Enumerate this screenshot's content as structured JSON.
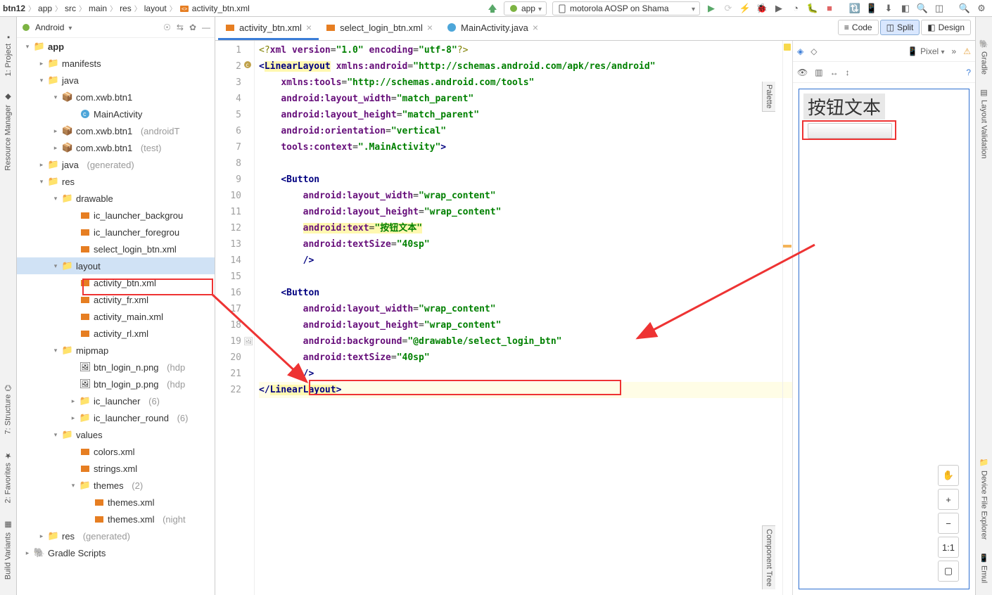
{
  "breadcrumb": {
    "root": "btn12",
    "p1": "app",
    "p2": "src",
    "p3": "main",
    "p4": "res",
    "p5": "layout",
    "file": "activity_btn.xml"
  },
  "run_config": "app",
  "device": "motorola AOSP on Shama",
  "proj_view_label": "Android",
  "tree": {
    "app": "app",
    "manifests": "manifests",
    "java": "java",
    "pkg1": "com.xwb.btn1",
    "mainact": "MainActivity",
    "pkg2": "com.xwb.btn1",
    "pkg2_suffix": "(androidT",
    "pkg3": "com.xwb.btn1",
    "pkg3_suffix": "(test)",
    "java_gen": "java",
    "java_gen_suffix": "(generated)",
    "res": "res",
    "drawable": "drawable",
    "ic_bg": "ic_launcher_backgrou",
    "ic_fg": "ic_launcher_foregrou",
    "sel_login": "select_login_btn.xml",
    "layout": "layout",
    "act_btn": "activity_btn.xml",
    "act_fr": "activity_fr.xml",
    "act_main": "activity_main.xml",
    "act_rl": "activity_rl.xml",
    "mipmap": "mipmap",
    "btnln": "btn_login_n.png",
    "btnln_s": "(hdp",
    "btnlp": "btn_login_p.png",
    "btnlp_s": "(hdp",
    "ic_launcher": "ic_launcher",
    "ic_launcher_c": "(6)",
    "ic_launcher_r": "ic_launcher_round",
    "ic_launcher_rc": "(6)",
    "values": "values",
    "colors": "colors.xml",
    "strings": "strings.xml",
    "themes_d": "themes",
    "themes_c": "(2)",
    "themes1": "themes.xml",
    "themes2": "themes.xml",
    "themes2_s": "(night",
    "res_gen": "res",
    "res_gen_s": "(generated)",
    "gradle": "Gradle Scripts"
  },
  "tabs": {
    "t1": "activity_btn.xml",
    "t2": "select_login_btn.xml",
    "t3": "MainActivity.java"
  },
  "view_switch": {
    "code": "Code",
    "split": "Split",
    "design": "Design"
  },
  "code_lines": {
    "l1_a": "<?",
    "l1_b": "xml version",
    "l1_c": "=",
    "l1_d": "\"1.0\"",
    "l1_e": " encoding",
    "l1_f": "=",
    "l1_g": "\"utf-8\"",
    "l1_h": "?>",
    "l2_a": "<",
    "l2_b": "LinearLayout",
    "l2_c": " ",
    "l2_d": "xmlns:android",
    "l2_e": "=",
    "l2_f": "\"http://schemas.android.com/apk/res/android\"",
    "l3_a": "xmlns:tools",
    "l3_b": "=",
    "l3_c": "\"http://schemas.android.com/tools\"",
    "l4_a": "android:layout_width",
    "l4_b": "=",
    "l4_c": "\"match_parent\"",
    "l5_a": "android:layout_height",
    "l5_b": "=",
    "l5_c": "\"match_parent\"",
    "l6_a": "android:orientation",
    "l6_b": "=",
    "l6_c": "\"vertical\"",
    "l7_a": "tools:context",
    "l7_b": "=",
    "l7_c": "\".MainActivity\"",
    "l7_d": ">",
    "l9_a": "<",
    "l9_b": "Button",
    "l10_a": "android:layout_width",
    "l10_b": "=",
    "l10_c": "\"wrap_content\"",
    "l11_a": "android:layout_height",
    "l11_b": "=",
    "l11_c": "\"wrap_content\"",
    "l12_a": "android:text",
    "l12_b": "=",
    "l12_c": "\"按钮文本\"",
    "l13_a": "android:textSize",
    "l13_b": "=",
    "l13_c": "\"40sp\"",
    "l14_a": "/>",
    "l16_a": "<",
    "l16_b": "Button",
    "l17_a": "android:layout_width",
    "l17_b": "=",
    "l17_c": "\"wrap_content\"",
    "l18_a": "android:layout_height",
    "l18_b": "=",
    "l18_c": "\"wrap_content\"",
    "l19_a": "android:background",
    "l19_b": "=",
    "l19_c": "\"@drawable/select_login_btn\"",
    "l20_a": "android:textSize",
    "l20_b": "=",
    "l20_c": "\"40sp\"",
    "l21_a": "/>",
    "l22_a": "</",
    "l22_b": "LinearLayout",
    "l22_c": ">"
  },
  "line_nums": [
    "1",
    "2",
    "3",
    "4",
    "5",
    "6",
    "7",
    "8",
    "9",
    "10",
    "11",
    "12",
    "13",
    "14",
    "15",
    "16",
    "17",
    "18",
    "19",
    "20",
    "21",
    "22"
  ],
  "preview": {
    "device": "Pixel",
    "btn1_text": "按钮文本",
    "one_to_one": "1:1"
  },
  "side_tabs": {
    "project": "1: Project",
    "res_mgr": "Resource Manager",
    "structure": "7: Structure",
    "favorites": "2: Favorites",
    "build_var": "Build Variants",
    "gradle": "Gradle",
    "layout_val": "Layout Validation",
    "dev_explorer": "Device File Explorer",
    "emul": "Emul",
    "palette": "Palette",
    "comp_tree": "Component Tree"
  }
}
